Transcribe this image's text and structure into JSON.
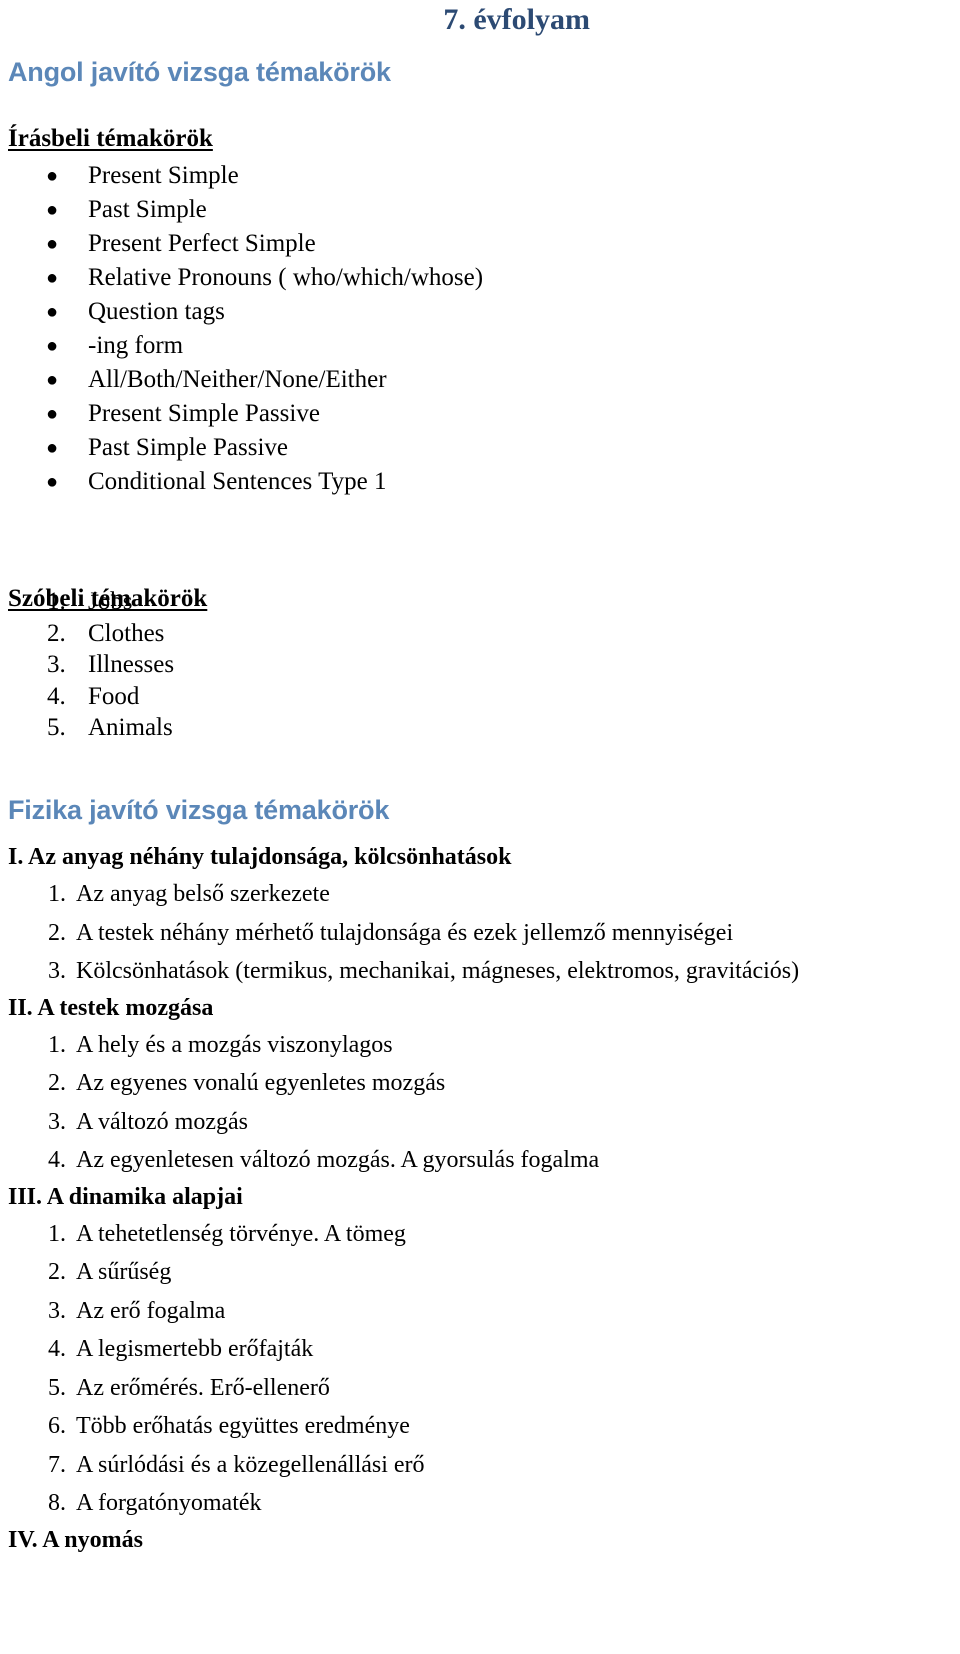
{
  "document": {
    "grade_title": "7. évfolyam",
    "colors": {
      "grade_title_blue": "#2c4a73",
      "subject_heading_blue": "#5b87b8",
      "body_text": "#000000",
      "background": "#ffffff"
    }
  },
  "english": {
    "subject_heading": "Angol javító vizsga témakörök",
    "written": {
      "heading": "Írásbeli témakörök",
      "bullet_glyph": "●",
      "items": [
        "Present Simple",
        "Past Simple",
        "Present Perfect Simple",
        "Relative Pronouns ( who/which/whose)",
        "Question tags",
        "-ing form",
        "All/Both/Neither/None/Either",
        "Present Simple Passive",
        "Past Simple Passive",
        "Conditional Sentences Type 1"
      ]
    },
    "oral": {
      "heading": "Szóbeli témakörök",
      "items": [
        {
          "number": "1.",
          "text": "Jobs"
        },
        {
          "number": "2.",
          "text": "Clothes"
        },
        {
          "number": "3.",
          "text": "Illnesses"
        },
        {
          "number": "4.",
          "text": "Food"
        },
        {
          "number": "5.",
          "text": "Animals"
        }
      ]
    }
  },
  "physics": {
    "subject_heading": "Fizika javító vizsga témakörök",
    "sections": [
      {
        "roman": "I.",
        "title": "Az anyag néhány tulajdonsága, kölcsönhatások",
        "items": [
          {
            "number": "1.",
            "text": "Az anyag belső szerkezete"
          },
          {
            "number": "2.",
            "text": "A testek néhány mérhető tulajdonsága és ezek jellemző mennyiségei"
          },
          {
            "number": "3.",
            "text": "Kölcsönhatások (termikus, mechanikai, mágneses, elektromos, gravitációs)"
          }
        ]
      },
      {
        "roman": "II.",
        "title": "A testek mozgása",
        "items": [
          {
            "number": "1.",
            "text": "A hely és a mozgás viszonylagos"
          },
          {
            "number": "2.",
            "text": "Az egyenes vonalú egyenletes mozgás"
          },
          {
            "number": "3.",
            "text": "A változó mozgás"
          },
          {
            "number": "4.",
            "text": "Az egyenletesen változó mozgás. A gyorsulás fogalma"
          }
        ]
      },
      {
        "roman": "III.",
        "title": "A dinamika alapjai",
        "items": [
          {
            "number": "1.",
            "text": "A tehetetlenség törvénye. A tömeg"
          },
          {
            "number": "2.",
            "text": "A sűrűség"
          },
          {
            "number": "3.",
            "text": "Az erő fogalma"
          },
          {
            "number": "4.",
            "text": "A legismertebb erőfajták"
          },
          {
            "number": "5.",
            "text": "Az erőmérés. Erő-ellenerő"
          },
          {
            "number": "6.",
            "text": "Több erőhatás együttes eredménye"
          },
          {
            "number": "7.",
            "text": "A súrlódási és a közegellenállási erő"
          },
          {
            "number": "8.",
            "text": "A forgatónyomaték"
          }
        ]
      },
      {
        "roman": "IV.",
        "title": "A nyomás",
        "items": []
      }
    ]
  }
}
